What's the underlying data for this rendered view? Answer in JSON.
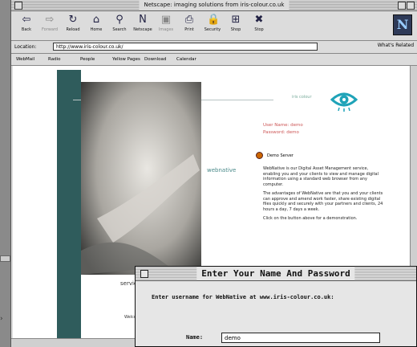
{
  "window": {
    "title": "Netscape: imaging solutions from iris-colour.co.uk"
  },
  "toolbar": {
    "buttons": [
      {
        "label": "Back",
        "icon": "back-arrow-icon",
        "glyph": "⇦",
        "enabled": true
      },
      {
        "label": "Forward",
        "icon": "forward-arrow-icon",
        "glyph": "⇨",
        "enabled": false
      },
      {
        "label": "Reload",
        "icon": "reload-icon",
        "glyph": "↻",
        "enabled": true
      },
      {
        "label": "Home",
        "icon": "home-icon",
        "glyph": "⌂",
        "enabled": true
      },
      {
        "label": "Search",
        "icon": "search-icon",
        "glyph": "⚲",
        "enabled": true
      },
      {
        "label": "Netscape",
        "icon": "netscape-n-icon",
        "glyph": "N",
        "enabled": true
      },
      {
        "label": "Images",
        "icon": "images-icon",
        "glyph": "▣",
        "enabled": false
      },
      {
        "label": "Print",
        "icon": "print-icon",
        "glyph": "⎙",
        "enabled": true
      },
      {
        "label": "Security",
        "icon": "lock-icon",
        "glyph": "🔒",
        "enabled": true
      },
      {
        "label": "Shop",
        "icon": "shop-icon",
        "glyph": "⊞",
        "enabled": true
      },
      {
        "label": "Stop",
        "icon": "stop-icon",
        "glyph": "✖",
        "enabled": true
      }
    ]
  },
  "location": {
    "label": "Location:",
    "url": "http://www.iris-colour.co.uk/",
    "whats_related": "What's Related"
  },
  "directory": [
    "WebMail",
    "Radio",
    "People",
    "Yellow Pages",
    "Download",
    "Calendar"
  ],
  "page": {
    "brand": "iris colour",
    "login_line1": "User Name: demo",
    "login_line2": "Password: demo",
    "demo_label": "Demo Server",
    "product": "webnative",
    "paragraphs": [
      "WebNative is our Digital Asset Management service, enabling you and your clients to view and manage digital information using a standard web browser from any computer.",
      "The advantages of WebNative are that you and your clients can approve and amend work faster, share existing digital files quickly and securely with your partners and clients, 24 hours a day, 7 days a week.",
      "Click on the button above for a demonstration."
    ],
    "services": "services",
    "welcome": "Welcome"
  },
  "dialog": {
    "title": "Enter Your Name And Password",
    "prompt": "Enter username for WebNative at www.iris-colour.co.uk:",
    "name_label": "Name:",
    "name_value": "demo"
  },
  "colors": {
    "teal": "#2f5c5c",
    "accent_eye": "#1fa3b8",
    "login_red": "#c55"
  }
}
